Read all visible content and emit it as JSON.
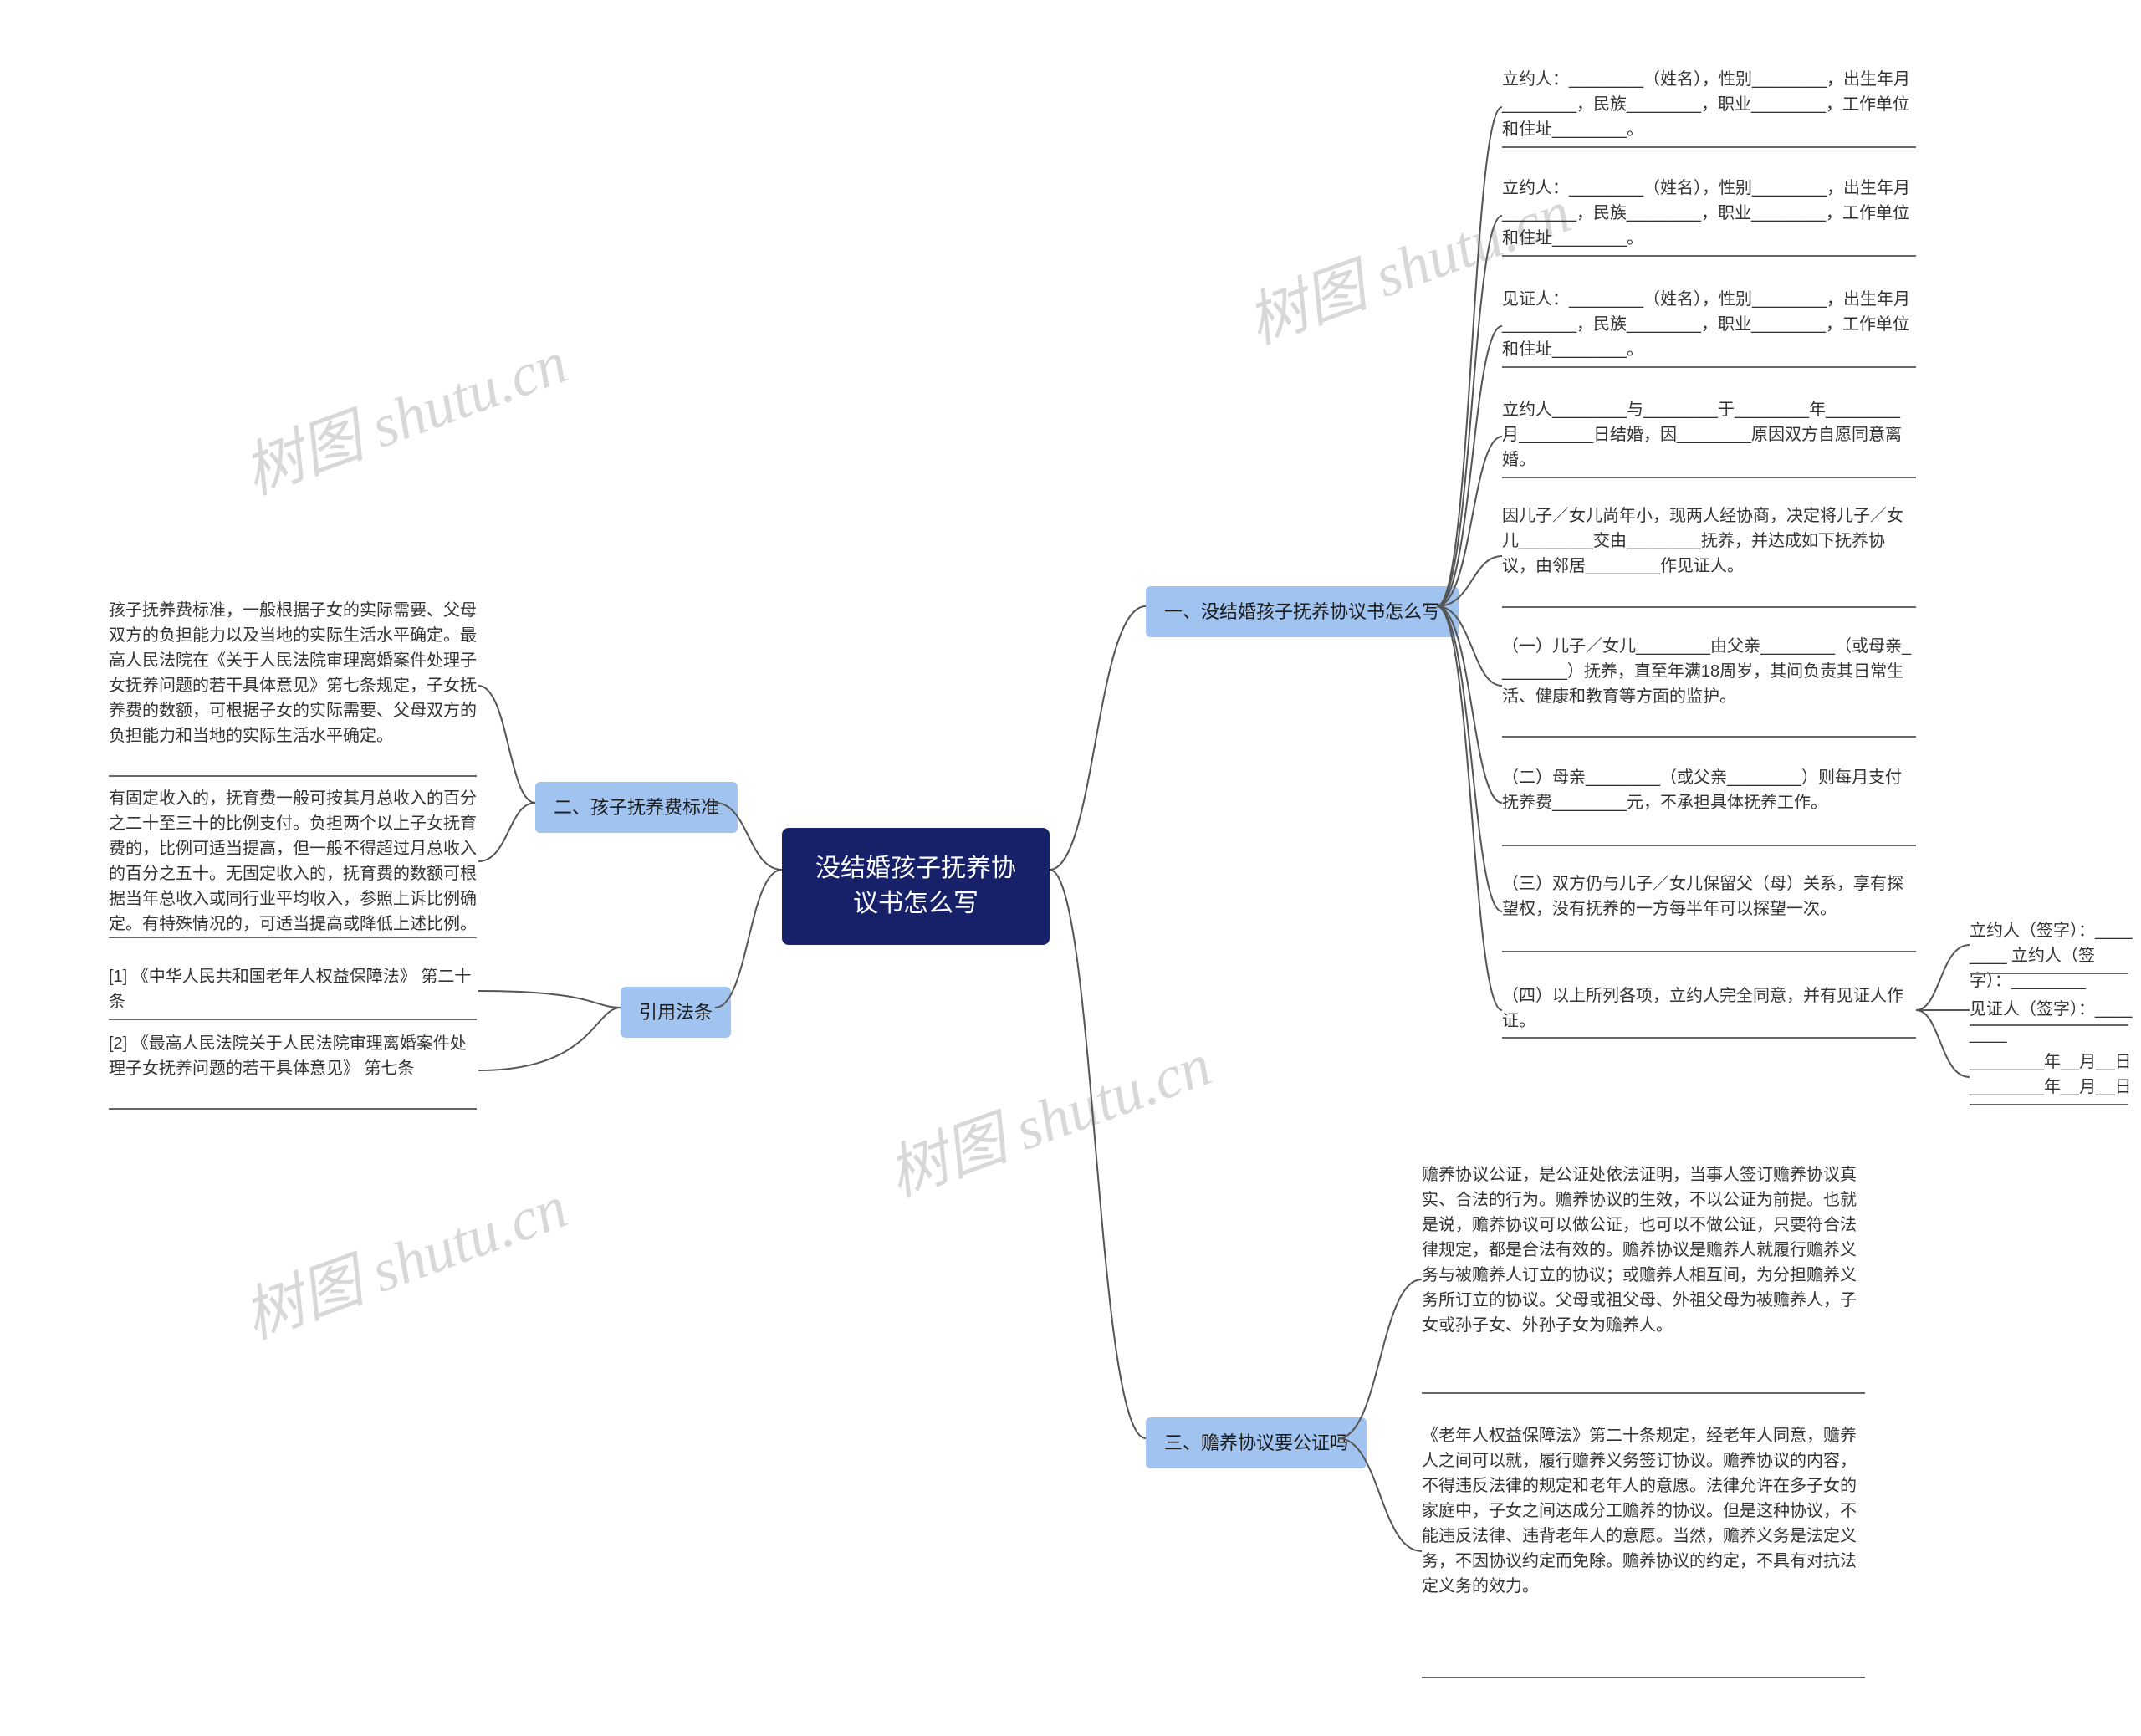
{
  "root": {
    "title": "没结婚孩子抚养协议书怎么写"
  },
  "branches": {
    "b1": {
      "label": "一、没结婚孩子抚养协议书怎么写"
    },
    "b2": {
      "label": "二、孩子抚养费标准"
    },
    "b3": {
      "label": "三、赡养协议要公证吗"
    },
    "b4": {
      "label": "引用法条"
    }
  },
  "b1_leaves": {
    "l1": "立约人：________（姓名），性别________，出生年月________，民族________，职业________，工作单位和住址________。",
    "l2": "立约人：________（姓名），性别________，出生年月________，民族________，职业________，工作单位和住址________。",
    "l3": "见证人：________（姓名），性别________，出生年月________，民族________，职业________，工作单位和住址________。",
    "l4": "立约人________与________于________年________月________日结婚，因________原因双方自愿同意离婚。",
    "l5": "因儿子／女儿尚年小，现两人经协商，决定将儿子／女儿________交由________抚养，并达成如下抚养协议，由邻居________作见证人。",
    "l6": "（一）儿子／女儿________由父亲________（或母亲________）抚养，直至年满18周岁，其间负责其日常生活、健康和教育等方面的监护。",
    "l7": "（二）母亲________（或父亲________）则每月支付抚养费________元，不承担具体抚养工作。",
    "l8": "（三）双方仍与儿子／女儿保留父（母）关系，享有探望权，没有抚养的一方每半年可以探望一次。",
    "l9": "（四）以上所列各项，立约人完全同意，并有见证人作证。"
  },
  "b1_l9_sub": {
    "s1": "立约人（签字）：________ 立约人（签字）：________",
    "s2": "见证人（签字）：________",
    "s3": "________年__月__日________年__月__日"
  },
  "b2_leaves": {
    "l1": "孩子抚养费标准，一般根据子女的实际需要、父母双方的负担能力以及当地的实际生活水平确定。最高人民法院在《关于人民法院审理离婚案件处理子女抚养问题的若干具体意见》第七条规定，子女抚养费的数额，可根据子女的实际需要、父母双方的负担能力和当地的实际生活水平确定。",
    "l2": "有固定收入的，抚育费一般可按其月总收入的百分之二十至三十的比例支付。负担两个以上子女抚育费的，比例可适当提高，但一般不得超过月总收入的百分之五十。无固定收入的，抚育费的数额可根据当年总收入或同行业平均收入，参照上诉比例确定。有特殊情况的，可适当提高或降低上述比例。"
  },
  "b3_leaves": {
    "l1": "赡养协议公证，是公证处依法证明，当事人签订赡养协议真实、合法的行为。赡养协议的生效，不以公证为前提。也就是说，赡养协议可以做公证，也可以不做公证，只要符合法律规定，都是合法有效的。赡养协议是赡养人就履行赡养义务与被赡养人订立的协议；或赡养人相互间，为分担赡养义务所订立的协议。父母或祖父母、外祖父母为被赡养人，子女或孙子女、外孙子女为赡养人。",
    "l2": "《老年人权益保障法》第二十条规定，经老年人同意，赡养人之间可以就，履行赡养义务签订协议。赡养协议的内容，不得违反法律的规定和老年人的意愿。法律允许在多子女的家庭中，子女之间达成分工赡养的协议。但是这种协议，不能违反法律、违背老年人的意愿。当然，赡养义务是法定义务，不因协议约定而免除。赡养协议的约定，不具有对抗法定义务的效力。"
  },
  "b4_leaves": {
    "l1": "[1] 《中华人民共和国老年人权益保障法》 第二十条",
    "l2": "[2] 《最高人民法院关于人民法院审理离婚案件处理子女抚养问题的若干具体意见》 第七条"
  },
  "watermark": "树图 shutu.cn"
}
